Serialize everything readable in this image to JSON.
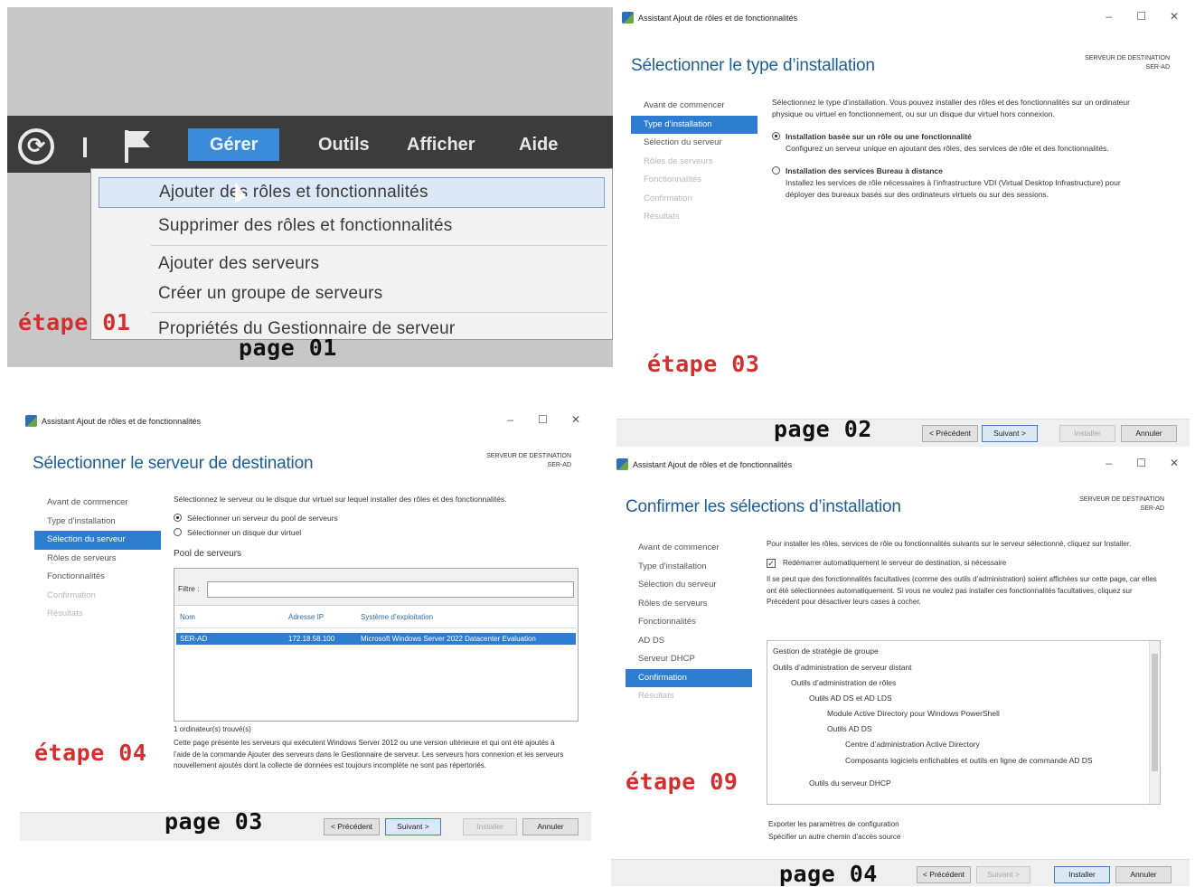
{
  "panel1": {
    "menu": [
      "Gérer",
      "Outils",
      "Afficher",
      "Aide"
    ],
    "dropdown": [
      "Ajouter des rôles et fonctionnalités",
      "Supprimer des rôles et fonctionnalités",
      "Ajouter des serveurs",
      "Créer un groupe de serveurs",
      "Propriétés du Gestionnaire de serveur"
    ],
    "etape": "étape 01",
    "page": "page 01"
  },
  "wizard_title": "Assistant Ajout de rôles et de fonctionnalités",
  "window_buttons": {
    "min": "–",
    "max": "☐",
    "close": "✕"
  },
  "dest_label": "SERVEUR DE DESTINATION",
  "dest_server": "SER-AD",
  "buttons": {
    "prev": "< Précédent",
    "next": "Suivant >",
    "install": "Installer",
    "cancel": "Annuler"
  },
  "panel2": {
    "heading": "Sélectionner le type d’installation",
    "nav": [
      "Avant de commencer",
      "Type d’installation",
      "Sélection du serveur",
      "Rôles de serveurs",
      "Fonctionnalités",
      "Confirmation",
      "Résultats"
    ],
    "intro": "Sélectionnez le type d’installation. Vous pouvez installer des rôles et des fonctionnalités sur un ordinateur physique ou virtuel en fonctionnement, ou sur un disque dur virtuel hors connexion.",
    "option1_title": "Installation basée sur un rôle ou une fonctionnalité",
    "option1_desc": "Configurez un serveur unique en ajoutant des rôles, des services de rôle et des fonctionnalités.",
    "option2_title": "Installation des services Bureau à distance",
    "option2_desc": "Installez les services de rôle nécessaires à l’infrastructure VDI (Virtual Desktop Infrastructure) pour déployer des bureaux basés sur des ordinateurs virtuels ou sur des sessions.",
    "etape": "étape 03",
    "page": "page 02"
  },
  "panel3": {
    "heading": "Sélectionner le serveur de destination",
    "nav": [
      "Avant de commencer",
      "Type d’installation",
      "Sélection du serveur",
      "Rôles de serveurs",
      "Fonctionnalités",
      "Confirmation",
      "Résultats"
    ],
    "intro": "Sélectionnez le serveur ou le disque dur virtuel sur lequel installer des rôles et des fonctionnalités.",
    "radio1": "Sélectionner un serveur du pool de serveurs",
    "radio2": "Sélectionner un disque dur virtuel",
    "pool_title": "Pool de serveurs",
    "filter_label": "Filtre :",
    "columns": [
      "Nom",
      "Adresse IP",
      "Système d’exploitation"
    ],
    "row": [
      "SER-AD",
      "172.18.58.100",
      "Microsoft Windows Server 2022 Datacenter Evaluation"
    ],
    "count": "1 ordinateur(s) trouvé(s)",
    "note": "Cette page présente les serveurs qui exécutent Windows Server 2012 ou une version ultérieure et qui ont été ajoutés à l’aide de la commande Ajouter des serveurs dans le Gestionnaire de serveur. Les serveurs hors connexion et les serveurs nouvellement ajoutés dont la collecte de données est toujours incomplète ne sont pas répertoriés.",
    "etape": "étape 04",
    "page": "page 03"
  },
  "panel4": {
    "heading": "Confirmer les sélections d’installation",
    "nav": [
      "Avant de commencer",
      "Type d’installation",
      "Sélection du serveur",
      "Rôles de serveurs",
      "Fonctionnalités",
      "AD DS",
      "Serveur DHCP",
      "Confirmation",
      "Résultats"
    ],
    "intro": "Pour installer les rôles, services de rôle ou fonctionnalités suivants sur le serveur sélectionné, cliquez sur Installer.",
    "restart": "Redémarrer automatiquement le serveur de destination, si nécessaire",
    "note": "Il se peut que des fonctionnalités facultatives (comme des outils d’administration) soient affichées sur cette page, car elles ont été sélectionnées automatiquement. Si vous ne voulez pas installer ces fonctionnalités facultatives, cliquez sur Précédent pour désactiver leurs cases à cocher.",
    "tree": [
      "Gestion de stratégie de groupe",
      "Outils d’administration de serveur distant",
      "Outils d’administration de rôles",
      "Outils AD DS et AD LDS",
      "Module Active Directory pour Windows PowerShell",
      "Outils AD DS",
      "Centre d’administration Active Directory",
      "Composants logiciels enfichables et outils en ligne de commande AD DS",
      "Outils du serveur DHCP"
    ],
    "export_link": "Exporter les paramètres de configuration",
    "source_link": "Spécifier un autre chemin d’accès source",
    "etape": "étape 09",
    "page": "page 04"
  }
}
